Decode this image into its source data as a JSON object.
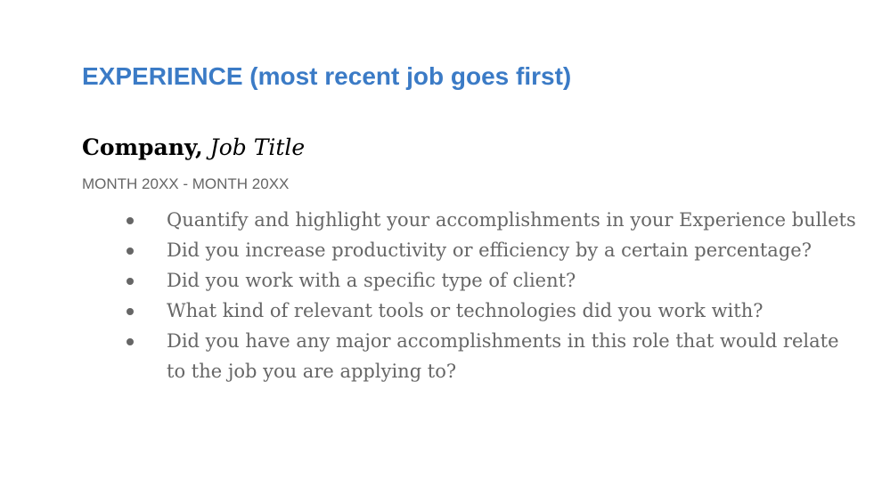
{
  "section": {
    "heading": "EXPERIENCE (most recent job goes first)"
  },
  "job": {
    "company": "Company,",
    "title": "Job Title",
    "dates": "MONTH 20XX - MONTH 20XX",
    "bullets": [
      "Quantify and highlight your accomplishments in your Experience bullets",
      "Did you increase productivity or efficiency by a certain percentage?",
      "Did you work with a specific type of client?",
      "What kind of relevant tools or technologies did you work with?",
      "Did you have any major accomplishments in this role that would relate to the job you are applying to?"
    ]
  },
  "colors": {
    "heading": "#3b7bc6",
    "body_text": "#666666",
    "job_line": "#000000"
  }
}
